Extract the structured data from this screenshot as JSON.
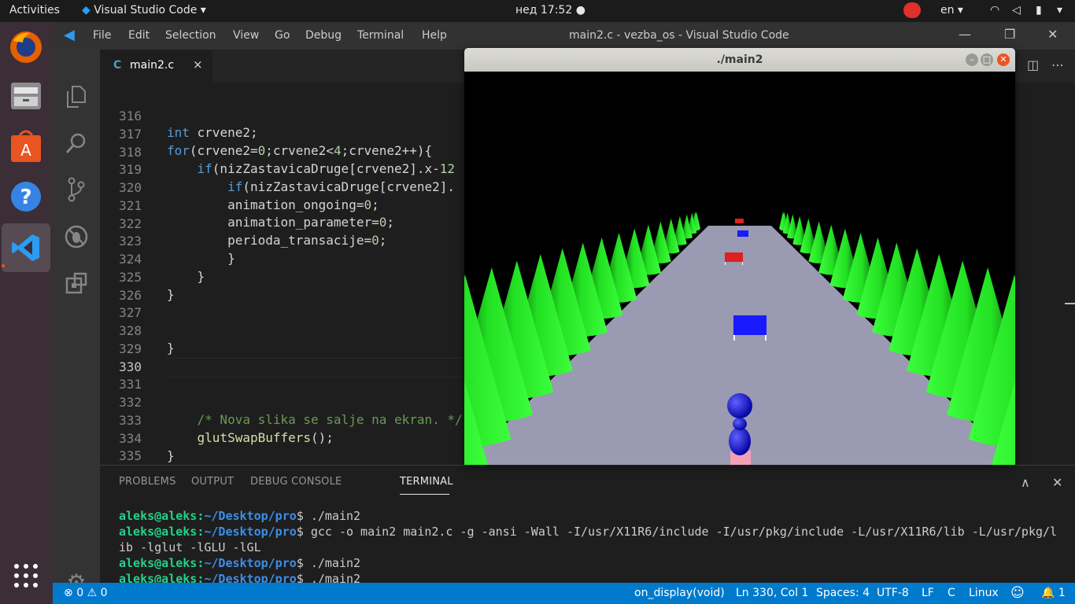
{
  "topbar": {
    "activities": "Activities",
    "app_menu": "Visual Studio Code ▾",
    "clock": "нед 17:52 ●",
    "lang": "en ▾"
  },
  "dock": {
    "items": [
      "firefox-icon",
      "files-icon",
      "software-center-icon",
      "help-icon",
      "vscode-icon",
      "show-apps-icon"
    ]
  },
  "menubar": {
    "items": [
      "File",
      "Edit",
      "Selection",
      "View",
      "Go",
      "Debug",
      "Terminal",
      "Help"
    ],
    "title": "main2.c - vezba_os - Visual Studio Code"
  },
  "tab": {
    "label": "main2.c",
    "lang_badge": "C",
    "close": "×"
  },
  "editor": {
    "line_numbers": [
      "316",
      "317",
      "318",
      "319",
      "320",
      "321",
      "322",
      "323",
      "324",
      "325",
      "326",
      "327",
      "328",
      "329",
      "330",
      "331",
      "332",
      "333",
      "334",
      "335"
    ],
    "current_line": "330"
  },
  "panel": {
    "tabs": [
      "PROBLEMS",
      "OUTPUT",
      "DEBUG CONSOLE",
      "TERMINAL"
    ],
    "active_tab": "TERMINAL",
    "prompt_user": "aleks@aleks",
    "prompt_path": "~/Desktop/pro",
    "lines": [
      {
        "cmd": " ./main2"
      },
      {
        "cmd": " gcc -o main2 main2.c -g -ansi -Wall -I/usr/X11R6/include -I/usr/pkg/include -L/usr/X11R6/lib -L/usr/pkg/l"
      },
      {
        "cont": "ib -lglut -lGLU -lGL"
      },
      {
        "cmd": " ./main2"
      },
      {
        "cmd": " ./main2"
      }
    ]
  },
  "statusbar": {
    "errors": "0",
    "warnings": "0",
    "function": "on_display(void)",
    "position": "Ln 330, Col 1",
    "spaces": "Spaces: 4",
    "encoding": "UTF-8",
    "eol": "LF",
    "language": "C",
    "os": "Linux",
    "notifications": "1"
  },
  "glwindow": {
    "title": "./main2"
  },
  "colors": {
    "accent": "#007acc",
    "terminal_user": "#23d18b",
    "terminal_path": "#3b8eea",
    "road": "#9a9ab2",
    "tree": "#22e022",
    "flag_red": "#e02020",
    "flag_blue": "#1a1aff"
  }
}
